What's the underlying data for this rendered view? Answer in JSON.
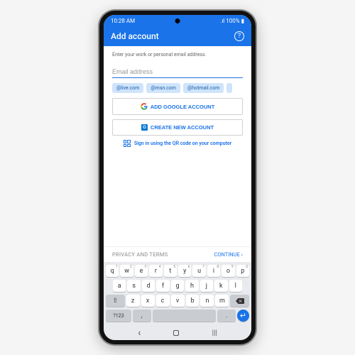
{
  "status": {
    "time": "10:28 AM",
    "signal": "⟡",
    "wifi": "⫸",
    "battery_text": ".ıl 100%",
    "batt_icon": "▮"
  },
  "app_bar": {
    "title": "Add account",
    "help": "?"
  },
  "content": {
    "prompt": "Enter your work or personal email address.",
    "email_placeholder": "Email address",
    "chips": [
      "@live.com",
      "@msn.com",
      "@hotmail.com"
    ],
    "google_btn": "ADD GOOGLE ACCOUNT",
    "create_btn": "CREATE NEW ACCOUNT",
    "qr_text": "Sign in using the QR code on your computer"
  },
  "footer": {
    "privacy": "PRIVACY AND TERMS",
    "continue": "CONTINUE",
    "chev": "›"
  },
  "keyboard": {
    "row1": [
      {
        "k": "q",
        "n": "1"
      },
      {
        "k": "w",
        "n": "2"
      },
      {
        "k": "e",
        "n": "3"
      },
      {
        "k": "r",
        "n": "4"
      },
      {
        "k": "t",
        "n": "5"
      },
      {
        "k": "y",
        "n": "6"
      },
      {
        "k": "u",
        "n": "7"
      },
      {
        "k": "i",
        "n": "8"
      },
      {
        "k": "o",
        "n": "9"
      },
      {
        "k": "p",
        "n": "0"
      }
    ],
    "row2": [
      "a",
      "s",
      "d",
      "f",
      "g",
      "h",
      "j",
      "k",
      "l"
    ],
    "row3": [
      "z",
      "x",
      "c",
      "v",
      "b",
      "n",
      "m"
    ],
    "shift": "⇧",
    "backspace": "⌫",
    "sym": "?123",
    "comma": ",",
    "period": ".",
    "enter": "↵"
  },
  "nav": {
    "back": "‹",
    "home": "",
    "recent": "|||"
  }
}
